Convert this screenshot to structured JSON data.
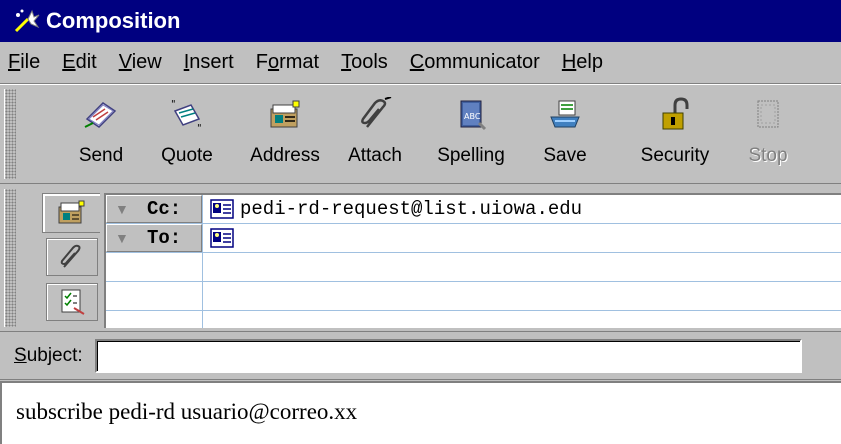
{
  "window": {
    "title": "Composition"
  },
  "menu": [
    {
      "label": "File",
      "mnemonic": "F",
      "rest": "ile"
    },
    {
      "label": "Edit",
      "mnemonic": "E",
      "rest": "dit"
    },
    {
      "label": "View",
      "mnemonic": "V",
      "rest": "iew"
    },
    {
      "label": "Insert",
      "mnemonic": "I",
      "rest": "nsert"
    },
    {
      "label": "Format",
      "pre": "F",
      "mnemonic": "o",
      "rest": "rmat"
    },
    {
      "label": "Tools",
      "mnemonic": "T",
      "rest": "ools"
    },
    {
      "label": "Communicator",
      "mnemonic": "C",
      "rest": "ommunicator"
    },
    {
      "label": "Help",
      "mnemonic": "H",
      "rest": "elp"
    }
  ],
  "toolbar": {
    "buttons": [
      {
        "label": "Send",
        "icon": "send-icon",
        "enabled": true
      },
      {
        "label": "Quote",
        "icon": "quote-icon",
        "enabled": true
      },
      {
        "label": "Address",
        "icon": "address-book-icon",
        "enabled": true
      },
      {
        "label": "Attach",
        "icon": "paperclip-icon",
        "enabled": true
      },
      {
        "label": "Spelling",
        "icon": "spelling-book-icon",
        "enabled": true
      },
      {
        "label": "Save",
        "icon": "save-icon",
        "enabled": true
      },
      {
        "label": "Security",
        "icon": "padlock-icon",
        "enabled": true
      },
      {
        "label": "Stop",
        "icon": "stop-icon",
        "enabled": false
      }
    ]
  },
  "addressing": {
    "side_tabs": [
      {
        "icon": "address-card-icon",
        "active": true
      },
      {
        "icon": "paperclip-icon",
        "active": false
      },
      {
        "icon": "checklist-icon",
        "active": false
      }
    ],
    "rows": [
      {
        "type": "Cc:",
        "value": "pedi-rd-request@list.uiowa.edu"
      },
      {
        "type": "To:",
        "value": ""
      }
    ]
  },
  "subject": {
    "label": "Subject:",
    "mnemonic": "S",
    "rest": "ubject:",
    "value": ""
  },
  "message": {
    "body": "subscribe pedi-rd usuario@correo.xx"
  },
  "colors": {
    "titlebar": "#000080",
    "chrome": "#c0c0c0",
    "grid_line": "#a0c0e0"
  }
}
